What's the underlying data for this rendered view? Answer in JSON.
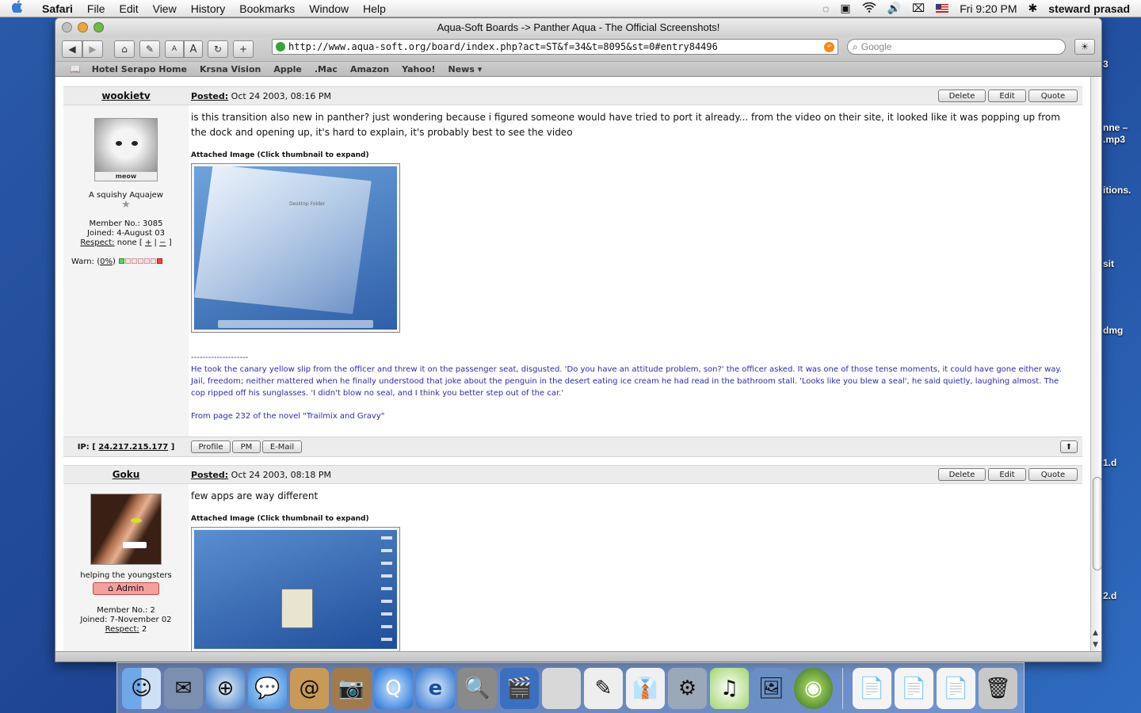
{
  "menubar": {
    "apple": "",
    "app": "Safari",
    "items": [
      "File",
      "Edit",
      "View",
      "History",
      "Bookmarks",
      "Window",
      "Help"
    ],
    "clock": "Fri 9:20 PM",
    "user": "steward prasad",
    "status_icons": [
      "sync-icon",
      "display-icon",
      "wifi-icon",
      "volume-icon",
      "battery-icon",
      "flag-icon",
      "bluetooth-icon"
    ]
  },
  "desktop_labels": [
    "3",
    "nne –\n.mp3",
    "itions.",
    "sit",
    "dmg",
    "1.d",
    "2.d"
  ],
  "window": {
    "title": "Aqua-Soft Boards -> Panther Aqua - The Official Screenshots!",
    "url": "http://www.aqua-soft.org/board/index.php?act=ST&f=34&t=8095&st=0#entry84496",
    "search_placeholder": "Google",
    "toolbar": {
      "back": "◀",
      "forward": "▶",
      "home": "⌂",
      "edit": "✎",
      "text_small": "A",
      "text_large": "A",
      "reload": "↻",
      "add": "+",
      "snap": "☀"
    },
    "bookmarks_icon": "📖",
    "bookmarks": [
      "Hotel Serapo Home",
      "Krsna Vision",
      "Apple",
      ".Mac",
      "Amazon",
      "Yahoo!",
      "News ▾"
    ]
  },
  "posts": [
    {
      "author": "wookietv",
      "posted_label": "Posted:",
      "posted": "Oct 24 2003, 08:16 PM",
      "actions": [
        "Delete",
        "Edit",
        "Quote"
      ],
      "user_title": "A squishy Aquajew",
      "avatar_caption": "meow",
      "member_no": "Member No.: 3085",
      "joined": "Joined: 4-August 03",
      "respect_label": "Respect:",
      "respect_value": "none [",
      "respect_plus": "+",
      "respect_sep": "|",
      "respect_minus": "−",
      "respect_close": "]",
      "warn_label": "Warn: (",
      "warn_pct": "0%",
      "warn_close": ")",
      "text": "is this transition also new in panther? just wondering because i figured someone would have tried to port it already... from the video on their site, it looked like it was popping up from the dock and opening up, it's hard to explain, it's probably best to see the video",
      "attach_label": "Attached Image (Click thumbnail to expand)",
      "thumb_text": "Desktop Folder",
      "sig_divider": "--------------------",
      "sig_text": "He took the canary yellow slip from the officer and threw it on the passenger seat, disgusted. 'Do you have an attitude problem, son?' the officer asked. It was one of those tense moments, it could have gone either way. Jail, freedom; neither mattered when he finally understood that joke about the penguin in the desert eating ice cream he had read in the bathroom stall. 'Looks like you blew a seal', he said quietly, laughing almost. The cop ripped off his sunglasses. 'I didn't blow no seal, and I think you better step out of the car.'",
      "sig_source": "From page 232 of the novel \"Trailmix and Gravy\"",
      "ip_label": "IP: [",
      "ip": "24.217.215.177",
      "ip_close": "]",
      "foot_buttons": [
        "Profile",
        "PM",
        "E-Mail"
      ],
      "top_button": "⬆"
    },
    {
      "author": "Goku",
      "posted_label": "Posted:",
      "posted": "Oct 24 2003, 08:18 PM",
      "actions": [
        "Delete",
        "Edit",
        "Quote"
      ],
      "user_title": "helping the youngsters",
      "badge": "Admin",
      "member_no": "Member No.: 2",
      "joined": "Joined: 7-November 02",
      "respect_label": "Respect:",
      "respect_value": "2",
      "text": "few apps are way different",
      "attach_label": "Attached Image (Click thumbnail to expand)"
    }
  ],
  "dock": {
    "apps": [
      "finder-icon",
      "mail-icon",
      "safari-icon",
      "ichat-icon",
      "address-book-icon",
      "iphoto-icon",
      "quicktime-icon",
      "internet-explorer-icon",
      "sherlock-icon",
      "imovie-icon",
      "system-prefs-icon",
      "textedit-icon",
      "tuxedo-icon",
      "network-icon",
      "itunes-icon",
      "preview-icon",
      "ipod-icon"
    ],
    "apps_glyphs": [
      "☺",
      "✉",
      "⊕",
      "💬",
      "@",
      "📷",
      "Q",
      "e",
      "🔍",
      "🎬",
      "",
      "✎",
      "👔",
      "⚙",
      "♫",
      "🖼",
      "◉"
    ],
    "docs": [
      "doc1",
      "doc2",
      "doc3",
      "trash"
    ],
    "docs_glyphs": [
      "📄",
      "📄",
      "📄",
      "🗑"
    ]
  },
  "colors": {
    "sig_blue": "#2b2bb0",
    "admin_badge": "#f3a0a0",
    "desktop": "#1d4391"
  }
}
